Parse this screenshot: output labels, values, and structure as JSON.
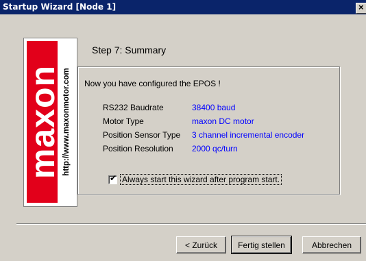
{
  "window": {
    "title": "Startup Wizard  [Node 1]",
    "close_glyph": "×"
  },
  "logo": {
    "brand": "maxon",
    "url": "http://www.maxonmotor.com"
  },
  "step": {
    "title": "Step 7: Summary"
  },
  "summary": {
    "intro": "Now you have configured the EPOS !",
    "rows": [
      {
        "label": "RS232 Baudrate",
        "value": "38400 baud"
      },
      {
        "label": "Motor Type",
        "value": "maxon DC motor"
      },
      {
        "label": "Position Sensor Type",
        "value": "3 channel incremental encoder"
      },
      {
        "label": "Position Resolution",
        "value": "2000 qc/turn"
      }
    ],
    "value_color": "#0000ff"
  },
  "option": {
    "checked": true,
    "check_glyph": "✔",
    "label": "Always start this wizard after program start."
  },
  "buttons": {
    "back": "< Zurück",
    "finish": "Fertig stellen",
    "cancel": "Abbrechen"
  },
  "colors": {
    "titlebar": "#0a246a",
    "logo_red": "#e2001a",
    "dialog_bg": "#d4d0c8"
  }
}
